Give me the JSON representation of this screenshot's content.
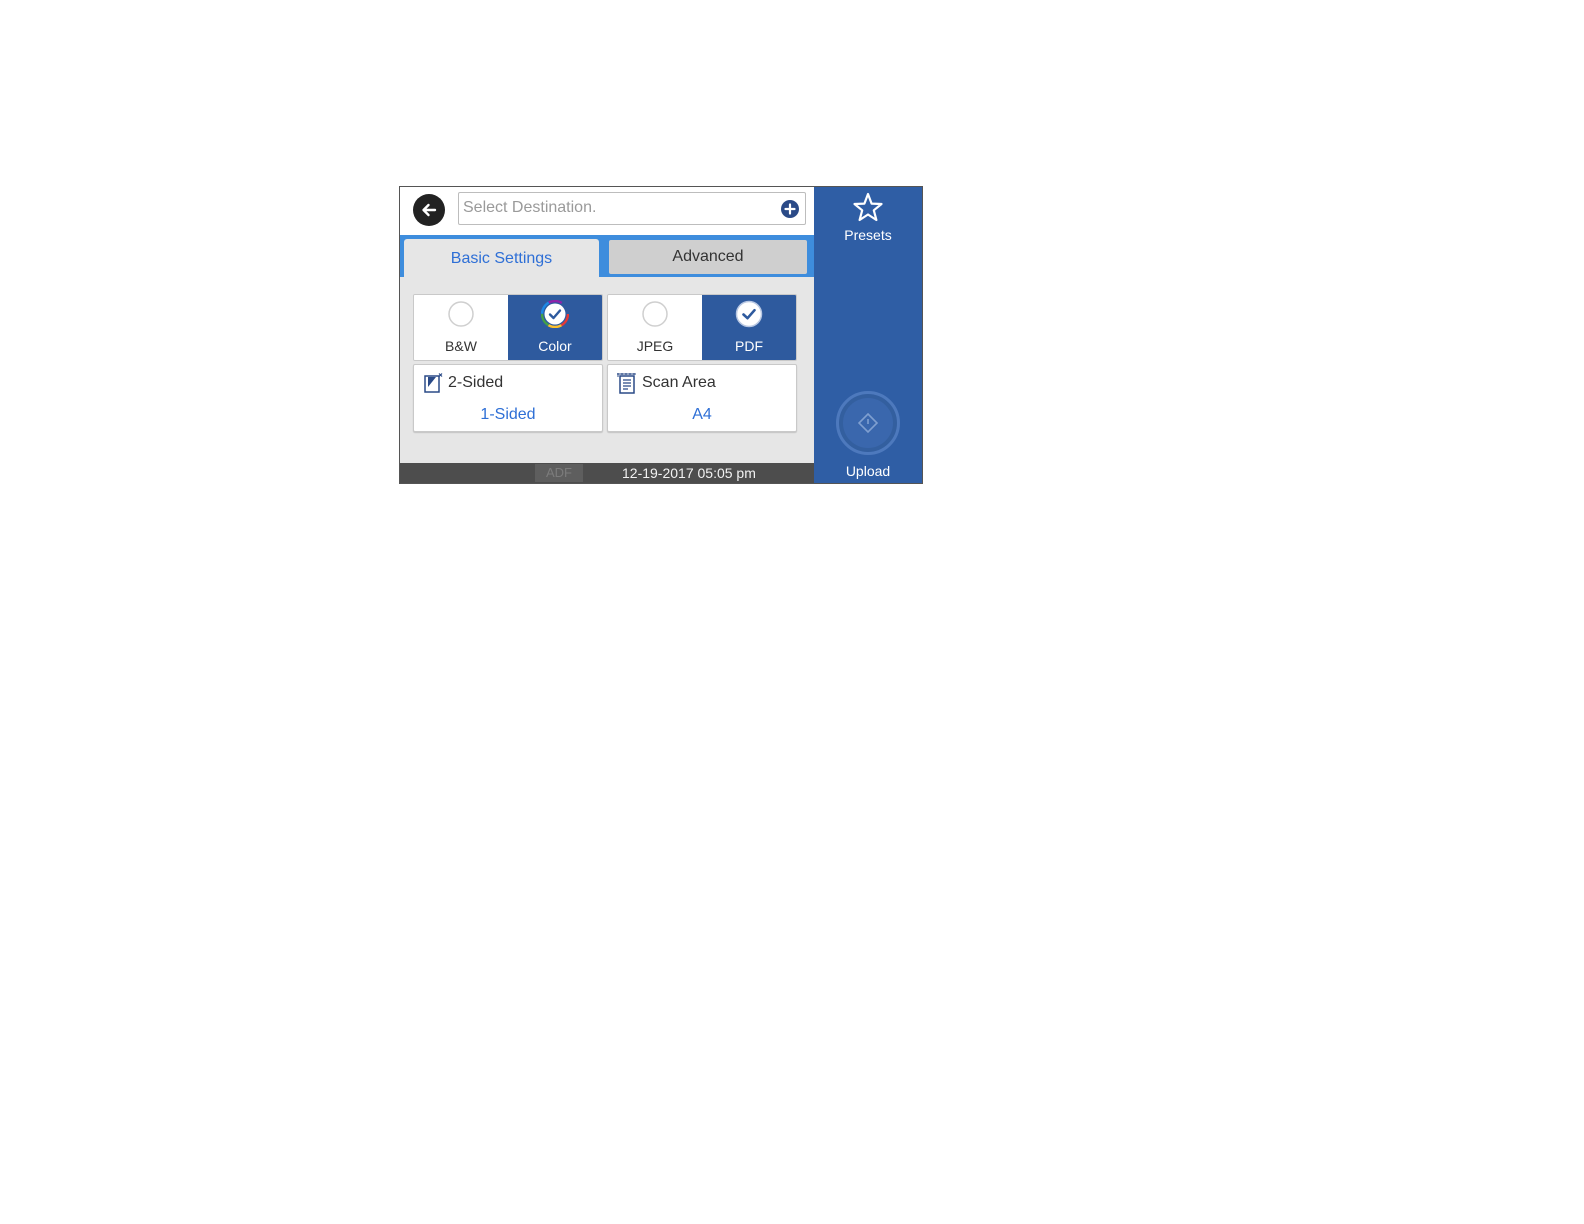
{
  "destination": {
    "placeholder": "Select Destination."
  },
  "tabs": {
    "basic": "Basic Settings",
    "advanced": "Advanced"
  },
  "color_mode": {
    "bw": "B&W",
    "color": "Color",
    "selected": "Color"
  },
  "file_format": {
    "jpeg": "JPEG",
    "pdf": "PDF",
    "selected": "PDF"
  },
  "settings": {
    "sided": {
      "title": "2-Sided",
      "value": "1-Sided"
    },
    "scan_area": {
      "title": "Scan Area",
      "value": "A4"
    }
  },
  "status_bar": {
    "source": "ADF",
    "datetime": "12-19-2017 05:05 pm"
  },
  "sidebar": {
    "presets_label": "Presets",
    "upload_label": "Upload"
  },
  "colors": {
    "accent_blue": "#2e5a9e",
    "sidebar_blue": "#2f5ea5",
    "tab_blue": "#3e8ddd",
    "link_blue": "#2e6fd6"
  },
  "icons": [
    "back-arrow-icon",
    "add-circle-icon",
    "check-circle-icon",
    "two-sided-icon",
    "scan-area-icon",
    "star-icon",
    "start-diamond-icon"
  ]
}
